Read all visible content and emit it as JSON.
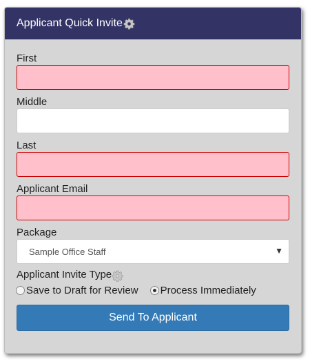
{
  "header": {
    "title": "Applicant Quick Invite",
    "icon": "gear-icon"
  },
  "form": {
    "first": {
      "label": "First",
      "value": "",
      "invalid": true
    },
    "middle": {
      "label": "Middle",
      "value": "",
      "invalid": false
    },
    "last": {
      "label": "Last",
      "value": "",
      "invalid": true
    },
    "email": {
      "label": "Applicant Email",
      "value": "",
      "invalid": true
    },
    "package": {
      "label": "Package",
      "selected": "Sample Office Staff"
    },
    "invite_type": {
      "label": "Applicant Invite Type",
      "icon": "gear-icon",
      "options": [
        {
          "label": "Save to Draft for Review",
          "checked": false
        },
        {
          "label": "Process Immediately",
          "checked": true
        }
      ]
    },
    "submit_label": "Send To Applicant"
  },
  "colors": {
    "header_bg": "#333366",
    "panel_bg": "#d6d6d6",
    "invalid_bg": "#ffc0cb",
    "invalid_border": "#cc0000",
    "button_bg": "#337ab7"
  }
}
